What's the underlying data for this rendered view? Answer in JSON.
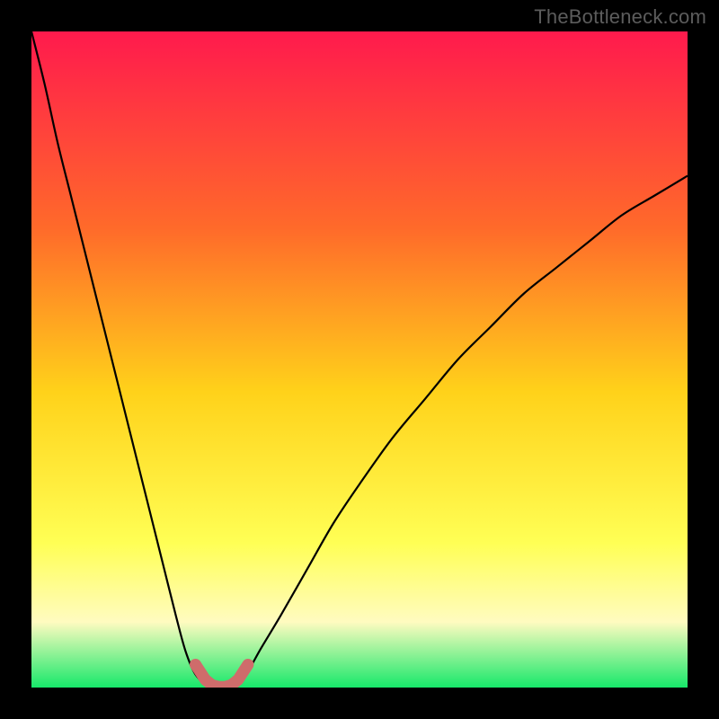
{
  "watermark": "TheBottleneck.com",
  "colors": {
    "page_bg": "#000000",
    "watermark": "#5c5c5c",
    "gradient_top": "#ff1a4d",
    "gradient_mid1": "#ff6a2a",
    "gradient_mid2": "#ffd21a",
    "gradient_mid3": "#ffff55",
    "gradient_mid4": "#fffbc0",
    "gradient_bottom": "#17e86a",
    "curve": "#000000",
    "marker": "#cf6c6b"
  },
  "chart_data": {
    "type": "line",
    "title": "",
    "xlabel": "",
    "ylabel": "",
    "xlim": [
      0,
      100
    ],
    "ylim": [
      0,
      100
    ],
    "series": [
      {
        "name": "left-branch",
        "x": [
          0,
          2,
          4,
          6,
          8,
          10,
          12,
          14,
          16,
          18,
          20,
          22,
          23.5,
          25,
          27
        ],
        "values": [
          100,
          92,
          83,
          75,
          67,
          59,
          51,
          43,
          35,
          27,
          19,
          11,
          5.5,
          2,
          0
        ]
      },
      {
        "name": "right-branch",
        "x": [
          31,
          33,
          35,
          38,
          42,
          46,
          50,
          55,
          60,
          65,
          70,
          75,
          80,
          85,
          90,
          95,
          100
        ],
        "values": [
          0,
          2.5,
          6,
          11,
          18,
          25,
          31,
          38,
          44,
          50,
          55,
          60,
          64,
          68,
          72,
          75,
          78
        ]
      },
      {
        "name": "valley-floor-marker",
        "x": [
          25,
          26.5,
          27.5,
          28.5,
          29.5,
          30.5,
          31.5,
          33
        ],
        "values": [
          3.5,
          1.2,
          0.4,
          0.1,
          0.1,
          0.4,
          1.2,
          3.5
        ]
      }
    ],
    "valley_center_x": 29,
    "valley_min_y": 0
  }
}
